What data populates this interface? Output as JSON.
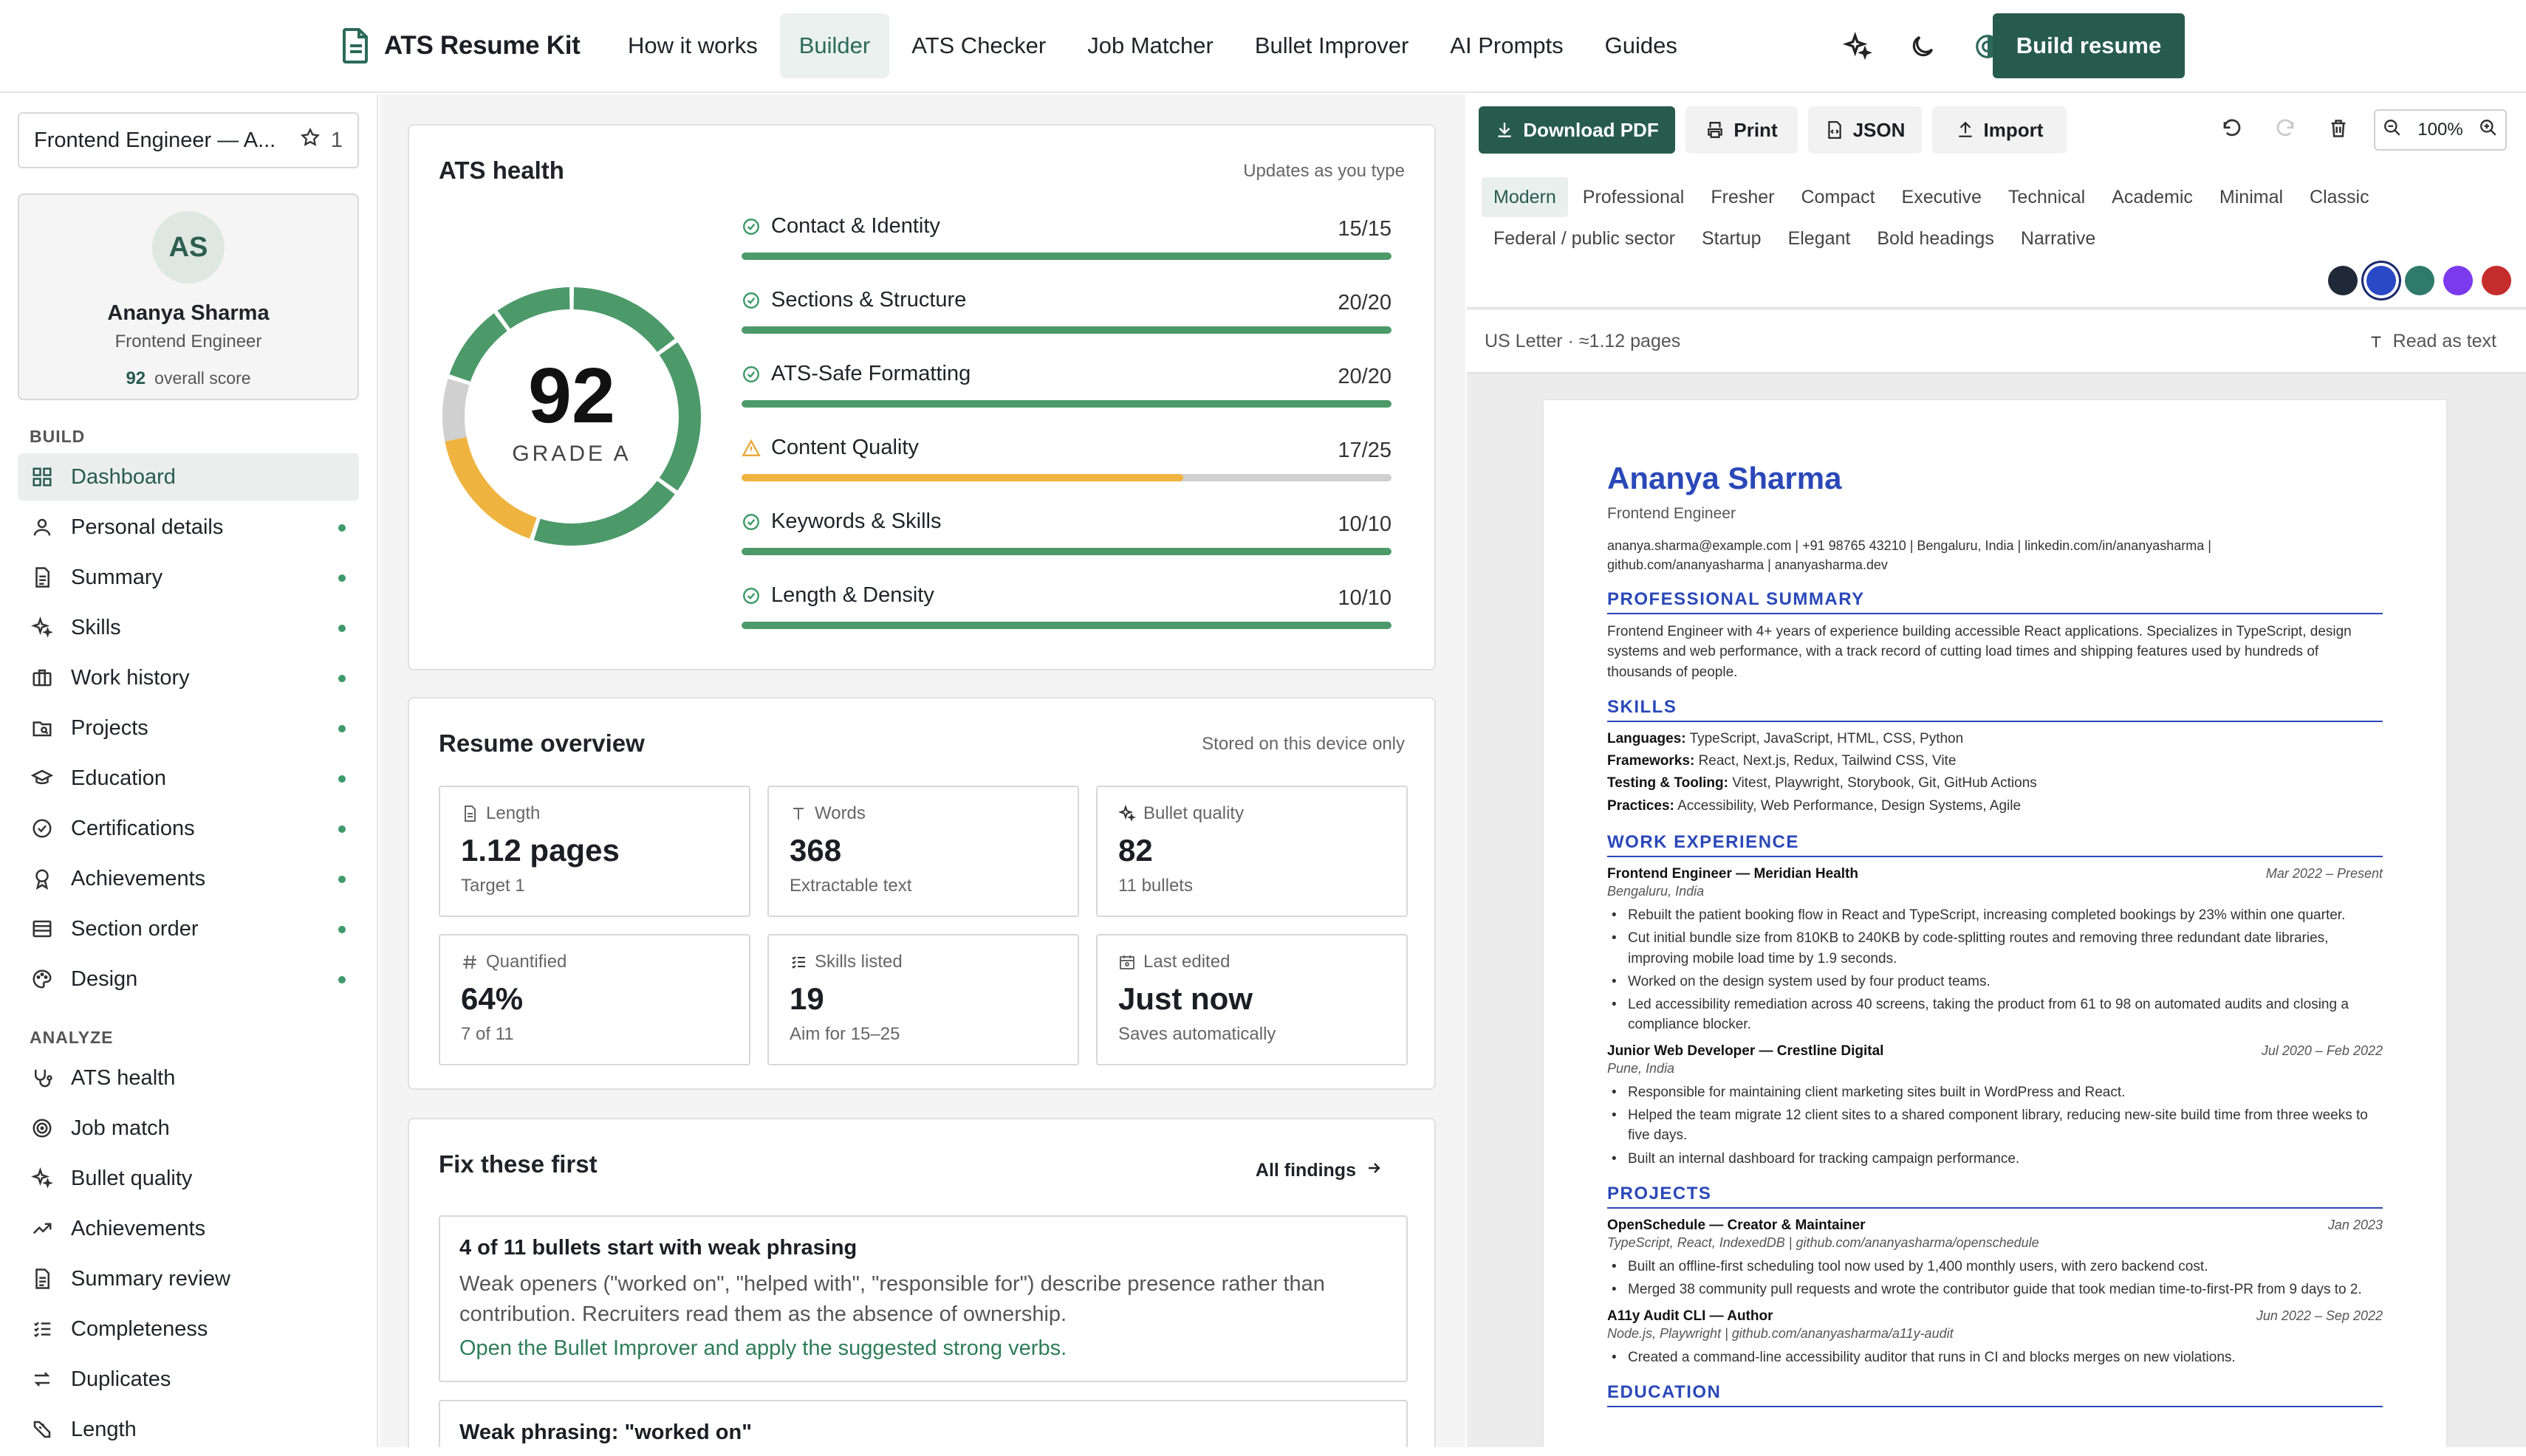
{
  "app": {
    "brand": "ATS Resume Kit"
  },
  "nav": {
    "items": [
      "How it works",
      "Builder",
      "ATS Checker",
      "Job Matcher",
      "Bullet Improver",
      "AI Prompts",
      "Guides"
    ],
    "active": "Builder",
    "cta": "Build resume",
    "icons": [
      "sparkle-icon",
      "moon-icon",
      "contrast-icon"
    ]
  },
  "sidebar": {
    "doc_title": "Frontend Engineer — A...",
    "doc_star_count": "1",
    "profile": {
      "initials": "AS",
      "name": "Ananya Sharma",
      "role": "Frontend Engineer",
      "score": "92",
      "score_label": "overall score"
    },
    "build_label": "BUILD",
    "build_items": [
      {
        "label": "Dashboard",
        "icon": "grid-icon",
        "active": true,
        "done": false
      },
      {
        "label": "Personal details",
        "icon": "person-icon",
        "done": true
      },
      {
        "label": "Summary",
        "icon": "document-icon",
        "done": true
      },
      {
        "label": "Skills",
        "icon": "sparkle-icon",
        "done": true
      },
      {
        "label": "Work history",
        "icon": "briefcase-icon",
        "done": true
      },
      {
        "label": "Projects",
        "icon": "folder-search-icon",
        "done": true
      },
      {
        "label": "Education",
        "icon": "graduation-cap-icon",
        "done": true
      },
      {
        "label": "Certifications",
        "icon": "check-circle-icon",
        "done": true
      },
      {
        "label": "Achievements",
        "icon": "award-icon",
        "done": true
      },
      {
        "label": "Section order",
        "icon": "list-order-icon",
        "done": true
      },
      {
        "label": "Design",
        "icon": "palette-icon",
        "done": true
      }
    ],
    "analyze_label": "ANALYZE",
    "analyze_items": [
      {
        "label": "ATS health",
        "icon": "stethoscope-icon"
      },
      {
        "label": "Job match",
        "icon": "target-icon"
      },
      {
        "label": "Bullet quality",
        "icon": "sparkle-icon"
      },
      {
        "label": "Achievements",
        "icon": "trend-up-icon"
      },
      {
        "label": "Summary review",
        "icon": "document-icon"
      },
      {
        "label": "Completeness",
        "icon": "checklist-icon"
      },
      {
        "label": "Duplicates",
        "icon": "swap-icon"
      },
      {
        "label": "Length",
        "icon": "ruler-icon"
      }
    ]
  },
  "ats_health": {
    "title": "ATS health",
    "subtitle": "Updates as you type",
    "score": "92",
    "grade": "GRADE A",
    "categories": [
      {
        "label": "Contact & Identity",
        "value": "15/15",
        "fraction": 1.0,
        "status": "ok"
      },
      {
        "label": "Sections & Structure",
        "value": "20/20",
        "fraction": 1.0,
        "status": "ok"
      },
      {
        "label": "ATS-Safe Formatting",
        "value": "20/20",
        "fraction": 1.0,
        "status": "ok"
      },
      {
        "label": "Content Quality",
        "value": "17/25",
        "fraction": 0.68,
        "status": "warn"
      },
      {
        "label": "Keywords & Skills",
        "value": "10/10",
        "fraction": 1.0,
        "status": "ok"
      },
      {
        "label": "Length & Density",
        "value": "10/10",
        "fraction": 1.0,
        "status": "ok"
      }
    ]
  },
  "overview": {
    "title": "Resume overview",
    "subtitle": "Stored on this device only",
    "stats": [
      {
        "label": "Length",
        "icon": "page-icon",
        "value": "1.12 pages",
        "note": "Target 1"
      },
      {
        "label": "Words",
        "icon": "text-t-icon",
        "value": "368",
        "note": "Extractable text"
      },
      {
        "label": "Bullet quality",
        "icon": "sparkle-icon",
        "value": "82",
        "note": "11 bullets"
      },
      {
        "label": "Quantified",
        "icon": "hash-icon",
        "value": "64%",
        "note": "7 of 11"
      },
      {
        "label": "Skills listed",
        "icon": "checklist-icon",
        "value": "19",
        "note": "Aim for 15–25"
      },
      {
        "label": "Last edited",
        "icon": "calendar-icon",
        "value": "Just now",
        "note": "Saves automatically"
      }
    ]
  },
  "fixes": {
    "title": "Fix these first",
    "link": "All findings",
    "items": [
      {
        "title": "4 of 11 bullets start with weak phrasing",
        "desc": "Weak openers (\"worked on\", \"helped with\", \"responsible for\") describe presence rather than contribution. Recruiters read them as the absence of ownership.",
        "action": "Open the Bullet Improver and apply the suggested strong verbs."
      },
      {
        "title": "Weak phrasing: \"worked on\""
      }
    ]
  },
  "preview": {
    "toolbar": {
      "download": "Download PDF",
      "print": "Print",
      "json": "JSON",
      "import": "Import",
      "zoom": "100%"
    },
    "templates_row1": [
      "Modern",
      "Professional",
      "Fresher",
      "Compact",
      "Executive",
      "Technical",
      "Academic",
      "Minimal",
      "Classic"
    ],
    "templates_row2": [
      "Federal / public sector",
      "Startup",
      "Elegant",
      "Bold headings",
      "Narrative"
    ],
    "active_template": "Modern",
    "swatches": [
      "#1f2937",
      "#2949c7",
      "#2f7a6a",
      "#7c3aed",
      "#c52d2d"
    ],
    "active_swatch": 1,
    "page_info": "US Letter · ≈1.12 pages",
    "read_as_text": "Read as text"
  },
  "resume": {
    "name": "Ananya Sharma",
    "role": "Frontend Engineer",
    "contact_line1": "ananya.sharma@example.com | +91 98765 43210 | Bengaluru, India | linkedin.com/in/ananyasharma |",
    "contact_line2": "github.com/ananyasharma | ananyasharma.dev",
    "h_summary": "PROFESSIONAL SUMMARY",
    "summary": "Frontend Engineer with 4+ years of experience building accessible React applications. Specializes in TypeScript, design systems and web performance, with a track record of cutting load times and shipping features used by hundreds of thousands of people.",
    "h_skills": "SKILLS",
    "skills": [
      {
        "k": "Languages:",
        "v": "TypeScript, JavaScript, HTML, CSS, Python"
      },
      {
        "k": "Frameworks:",
        "v": "React, Next.js, Redux, Tailwind CSS, Vite"
      },
      {
        "k": "Testing & Tooling:",
        "v": "Vitest, Playwright, Storybook, Git, GitHub Actions"
      },
      {
        "k": "Practices:",
        "v": "Accessibility, Web Performance, Design Systems, Agile"
      }
    ],
    "h_work": "WORK EXPERIENCE",
    "jobs": [
      {
        "title": "Frontend Engineer — Meridian Health",
        "date": "Mar 2022 – Present",
        "loc": "Bengaluru, India",
        "bullets": [
          "Rebuilt the patient booking flow in React and TypeScript, increasing completed bookings by 23% within one quarter.",
          "Cut initial bundle size from 810KB to 240KB by code-splitting routes and removing three redundant date libraries, improving mobile load time by 1.9 seconds.",
          "Worked on the design system used by four product teams.",
          "Led accessibility remediation across 40 screens, taking the product from 61 to 98 on automated audits and closing a compliance blocker."
        ]
      },
      {
        "title": "Junior Web Developer — Crestline Digital",
        "date": "Jul 2020 – Feb 2022",
        "loc": "Pune, India",
        "bullets": [
          "Responsible for maintaining client marketing sites built in WordPress and React.",
          "Helped the team migrate 12 client sites to a shared component library, reducing new-site build time from three weeks to five days.",
          "Built an internal dashboard for tracking campaign performance."
        ]
      }
    ],
    "h_projects": "PROJECTS",
    "projects": [
      {
        "title": "OpenSchedule — Creator & Maintainer",
        "date": "Jan 2023",
        "loc": "TypeScript, React, IndexedDB | github.com/ananyasharma/openschedule",
        "bullets": [
          "Built an offline-first scheduling tool now used by 1,400 monthly users, with zero backend cost.",
          "Merged 38 community pull requests and wrote the contributor guide that took median time-to-first-PR from 9 days to 2."
        ]
      },
      {
        "title": "A11y Audit CLI — Author",
        "date": "Jun 2022 – Sep 2022",
        "loc": "Node.js, Playwright | github.com/ananyasharma/a11y-audit",
        "bullets": [
          "Created a command-line accessibility auditor that runs in CI and blocks merges on new violations."
        ]
      }
    ],
    "h_education": "EDUCATION"
  }
}
